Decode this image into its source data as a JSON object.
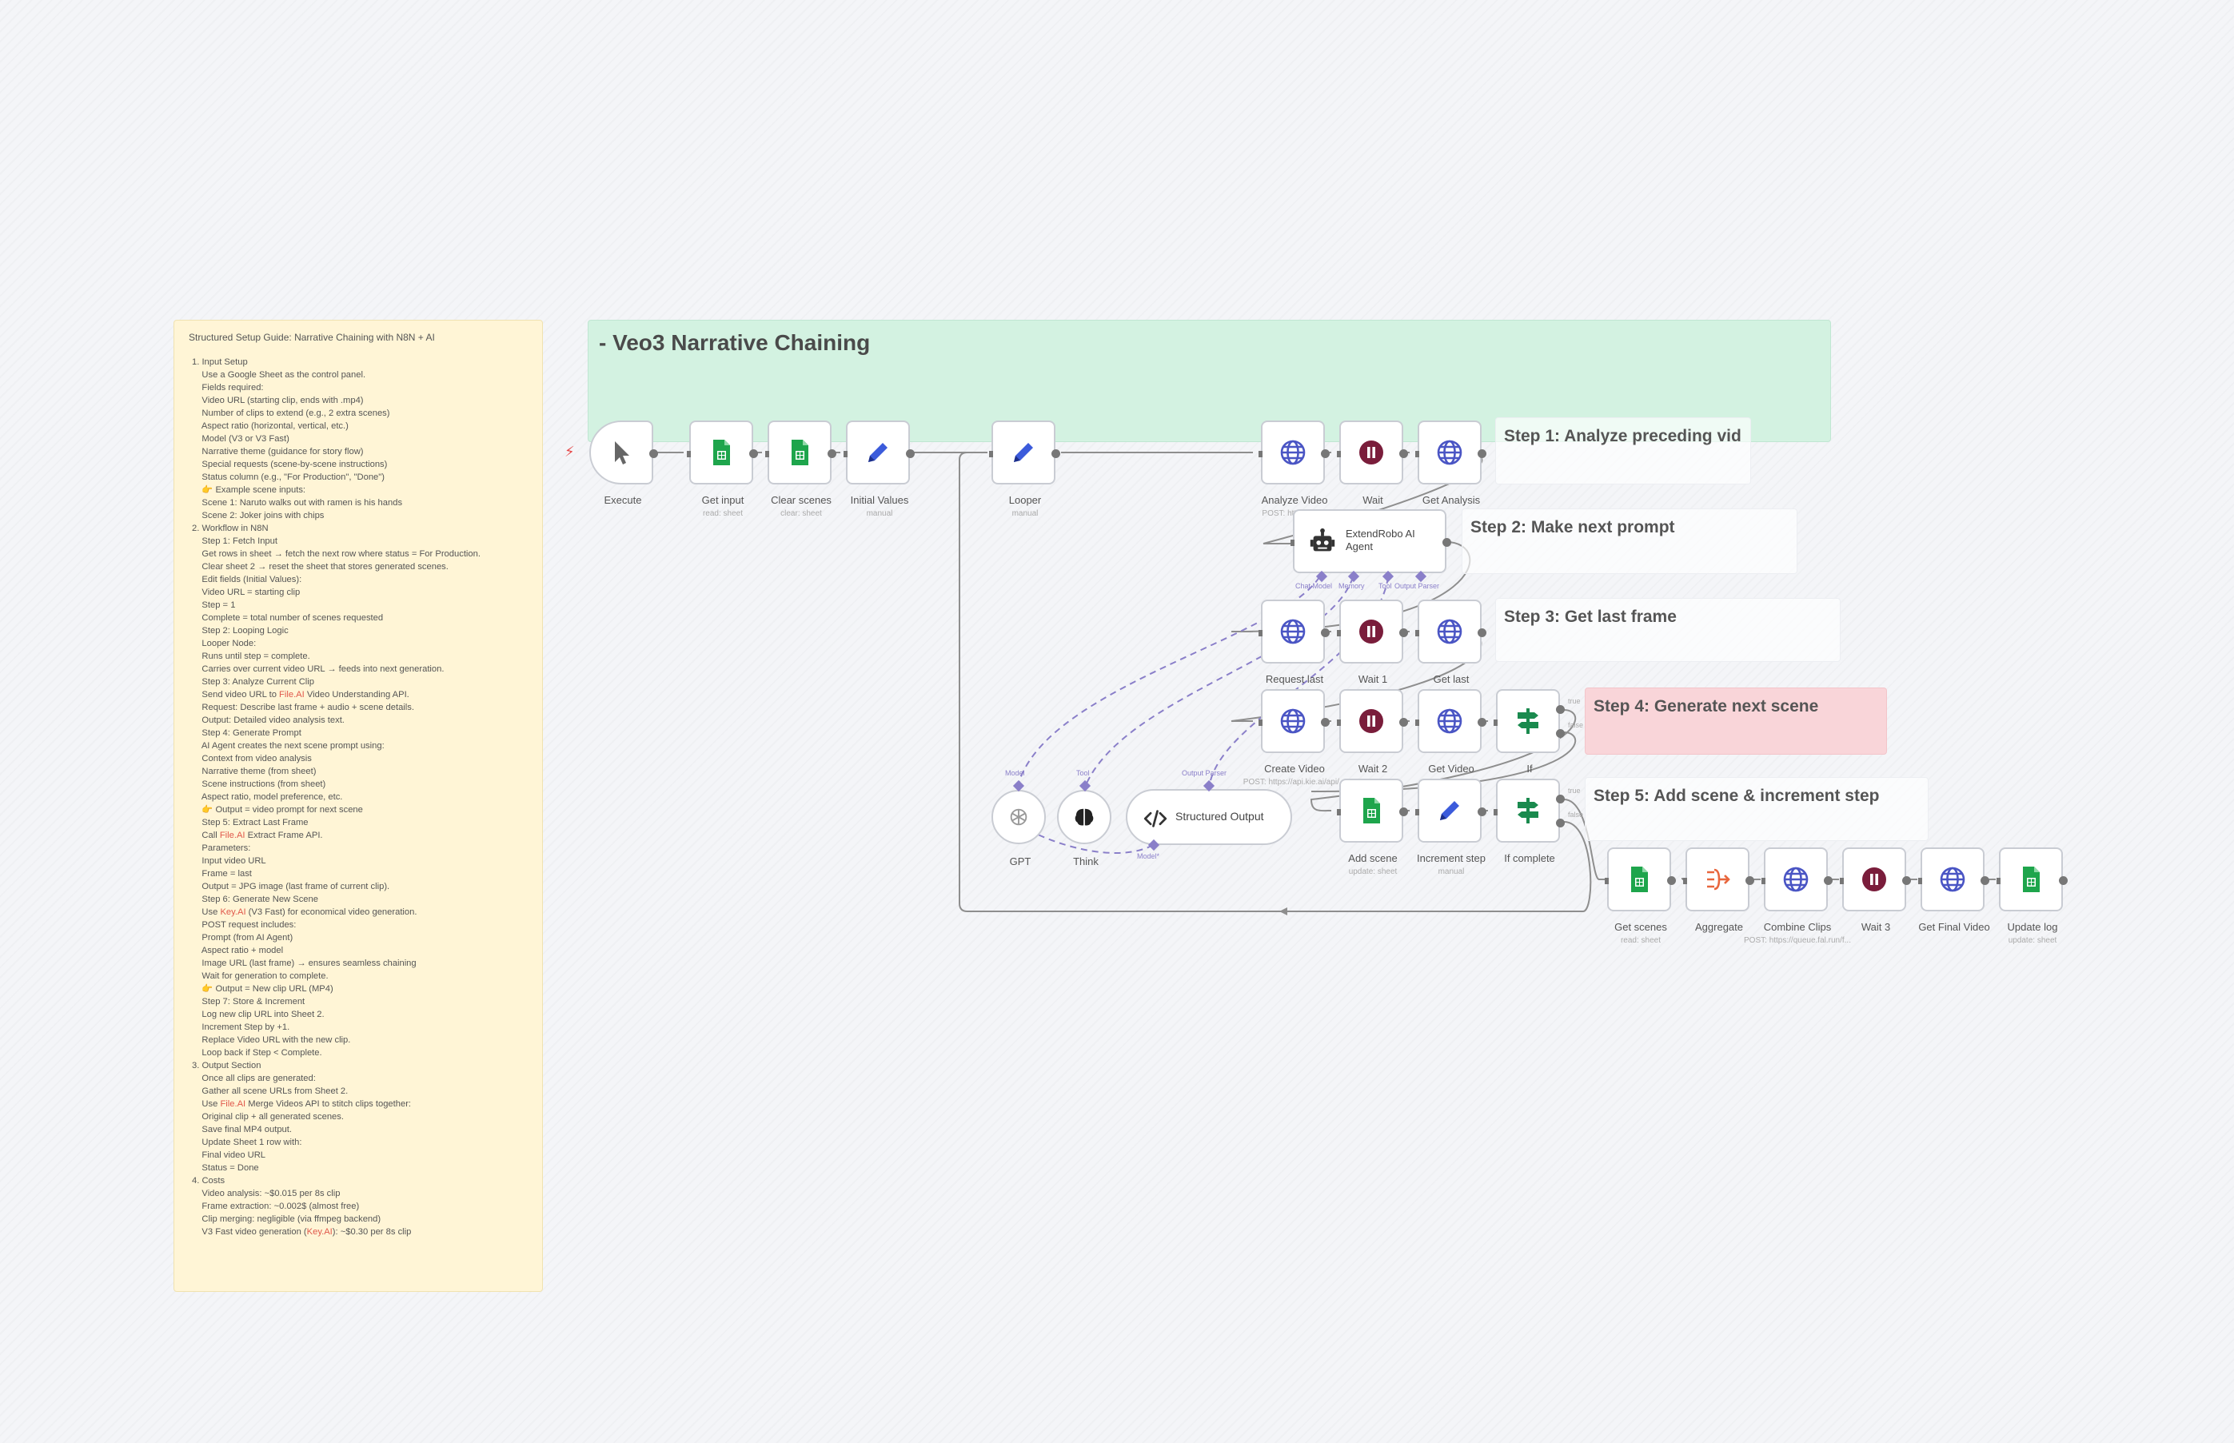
{
  "guide": {
    "title": "Structured Setup Guide: Narrative Chaining with N8N + AI",
    "lines": [
      "1. Input Setup",
      "    Use a Google Sheet as the control panel.",
      "    Fields required:",
      "    Video URL (starting clip, ends with .mp4)",
      "    Number of clips to extend (e.g., 2 extra scenes)",
      "    Aspect ratio (horizontal, vertical, etc.)",
      "    Model (V3 or V3 Fast)",
      "    Narrative theme (guidance for story flow)",
      "    Special requests (scene-by-scene instructions)",
      "    Status column (e.g., \"For Production\", \"Done\")",
      "    👉 Example scene inputs:",
      "    Scene 1: Naruto walks out with ramen is his hands",
      "    Scene 2: Joker joins with chips",
      "2. Workflow in N8N",
      "    Step 1: Fetch Input",
      "    Get rows in sheet → fetch the next row where status = For Production.",
      "    Clear sheet 2 → reset the sheet that stores generated scenes.",
      "    Edit fields (Initial Values):",
      "    Video URL = starting clip",
      "    Step = 1",
      "    Complete = total number of scenes requested",
      "    Step 2: Looping Logic",
      "    Looper Node:",
      "    Runs until step = complete.",
      "    Carries over current video URL → feeds into next generation.",
      "    Step 3: Analyze Current Clip",
      "    Send video URL to File.AI Video Understanding API.",
      "    Request: Describe last frame + audio + scene details.",
      "    Output: Detailed video analysis text.",
      "    Step 4: Generate Prompt",
      "    AI Agent creates the next scene prompt using:",
      "    Context from video analysis",
      "    Narrative theme (from sheet)",
      "    Scene instructions (from sheet)",
      "    Aspect ratio, model preference, etc.",
      "    👉 Output = video prompt for next scene",
      "    Step 5: Extract Last Frame",
      "    Call File.AI Extract Frame API.",
      "    Parameters:",
      "    Input video URL",
      "    Frame = last",
      "    Output = JPG image (last frame of current clip).",
      "    Step 6: Generate New Scene",
      "    Use Key.AI (V3 Fast) for economical video generation.",
      "    POST request includes:",
      "    Prompt (from AI Agent)",
      "    Aspect ratio + model",
      "    Image URL (last frame) → ensures seamless chaining",
      "    Wait for generation to complete.",
      "    👉 Output = New clip URL (MP4)",
      "    Step 7: Store & Increment",
      "    Log new clip URL into Sheet 2.",
      "    Increment Step by +1.",
      "    Replace Video URL with the new clip.",
      "    Loop back if Step < Complete.",
      "3. Output Section",
      "    Once all clips are generated:",
      "    Gather all scene URLs from Sheet 2.",
      "    Use File.AI Merge Videos API to stitch clips together:",
      "    Original clip + all generated scenes.",
      "    Save final MP4 output.",
      "    Update Sheet 1 row with:",
      "    Final video URL",
      "    Status = Done",
      "4. Costs",
      "    Video analysis: ~$0.015 per 8s clip",
      "    Frame extraction: ~0.002$ (almost free)",
      "    Clip merging: negligible (via ffmpeg backend)",
      "    V3 Fast video generation (Key.AI): ~$0.30 per 8s clip"
    ]
  },
  "banner": {
    "title": "- Veo3 Narrative Chaining"
  },
  "steps": [
    {
      "id": "step1",
      "title": "Step 1: Analyze preceding vid"
    },
    {
      "id": "step2",
      "title": "Step 2: Make next prompt"
    },
    {
      "id": "step3",
      "title": "Step 3: Get last frame"
    },
    {
      "id": "step4",
      "title": "Step 4: Generate next scene"
    },
    {
      "id": "step5",
      "title": "Step 5: Add scene & increment step"
    }
  ],
  "nodes": {
    "execute": {
      "label": "Execute",
      "icon": "cursor-icon"
    },
    "get_input": {
      "label": "Get input",
      "sub": "read: sheet",
      "icon": "sheets-icon"
    },
    "clear_scenes": {
      "label": "Clear scenes",
      "sub": "clear: sheet",
      "icon": "sheets-icon"
    },
    "initial_values": {
      "label": "Initial Values",
      "sub": "manual",
      "icon": "pencil-icon"
    },
    "looper": {
      "label": "Looper",
      "sub": "manual",
      "icon": "pencil-icon"
    },
    "analyze_video": {
      "label": "Analyze Video",
      "sub": "POST: https://ap...",
      "icon": "globe-icon"
    },
    "wait": {
      "label": "Wait",
      "icon": "pause-icon"
    },
    "get_analysis": {
      "label": "Get Analysis",
      "icon": "globe-icon"
    },
    "agent": {
      "label": "ExtendRobo AI Agent",
      "icon": "robot-icon"
    },
    "request_last": {
      "label": "Request last",
      "sub": "POST: h...",
      "icon": "globe-icon"
    },
    "wait1": {
      "label": "Wait 1",
      "icon": "pause-icon"
    },
    "get_last": {
      "label": "Get last",
      "icon": "globe-icon"
    },
    "create_video": {
      "label": "Create Video",
      "sub": "POST: https://api.kie.ai/api/...",
      "icon": "globe-icon"
    },
    "wait2": {
      "label": "Wait 2",
      "icon": "pause-icon"
    },
    "get_video": {
      "label": "Get Video",
      "icon": "globe-icon"
    },
    "if": {
      "label": "If",
      "icon": "if-icon",
      "true_label": "true",
      "false_label": "false"
    },
    "add_scene": {
      "label": "Add scene",
      "sub": "update: sheet",
      "icon": "sheets-icon"
    },
    "increment_step": {
      "label": "Increment step",
      "sub": "manual",
      "icon": "pencil-icon"
    },
    "if_complete": {
      "label": "If complete",
      "icon": "if-icon",
      "true_label": "true",
      "false_label": "false"
    },
    "get_scenes": {
      "label": "Get scenes",
      "sub": "read: sheet",
      "icon": "sheets-icon"
    },
    "aggregate": {
      "label": "Aggregate",
      "icon": "aggregate-icon"
    },
    "combine_clips": {
      "label": "Combine Clips",
      "sub": "POST: https://queue.fal.run/f...",
      "icon": "globe-icon"
    },
    "wait3": {
      "label": "Wait 3",
      "icon": "pause-icon"
    },
    "get_final_video": {
      "label": "Get Final Video",
      "icon": "globe-icon"
    },
    "update_log": {
      "label": "Update log",
      "sub": "update: sheet",
      "icon": "sheets-icon"
    },
    "gpt": {
      "label": "GPT",
      "icon": "openai-icon"
    },
    "think": {
      "label": "Think",
      "icon": "brain-icon"
    },
    "structured_output": {
      "label": "Structured Output",
      "icon": "code-icon"
    }
  },
  "agent_ports": {
    "chat_model": "Chat Model",
    "memory": "Memory",
    "tool": "Tool",
    "output_parser": "Output Parser"
  },
  "sub_ports": {
    "model": "Model",
    "tool": "Tool",
    "output_parser": "Output Parser",
    "parser_model": "Model*"
  },
  "colors": {
    "sheets": "#1ea54c",
    "pencil": "#3b5bdb",
    "globe": "#4a55c4",
    "pause": "#7a1d3b",
    "if": "#1a8a4e",
    "aggregate": "#e8663d",
    "connection": "#8e8e8e",
    "sub_connection": "#8a7fc9",
    "sticky_yellow": "#fff5d6",
    "sticky_green": "#d3f2e1",
    "sticky_red": "#f9d5d9"
  }
}
